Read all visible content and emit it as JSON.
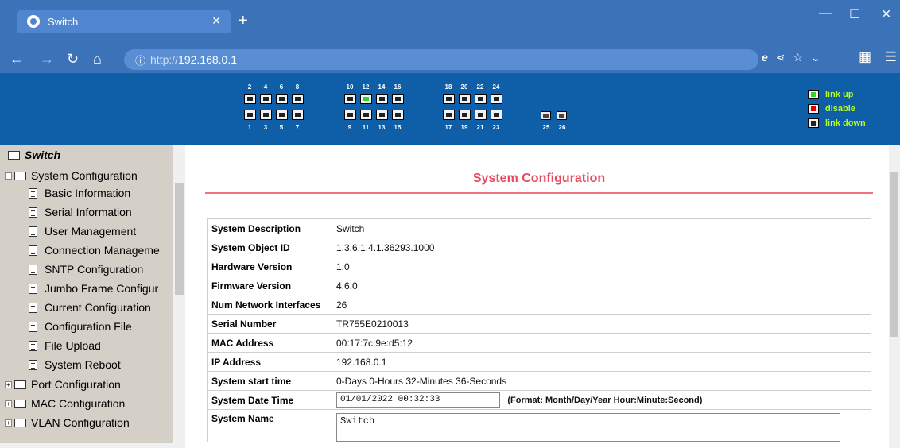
{
  "browser": {
    "tab_title": "Switch",
    "url_proto": "http://",
    "url_host": "192.168.0.1",
    "accent": "#3c72b8"
  },
  "ports": {
    "top_labels": [
      "2",
      "4",
      "6",
      "8",
      "10",
      "12",
      "14",
      "16",
      "18",
      "20",
      "22",
      "24"
    ],
    "bottom_labels": [
      "1",
      "3",
      "5",
      "7",
      "9",
      "11",
      "13",
      "15",
      "17",
      "19",
      "21",
      "23",
      "25",
      "26"
    ],
    "up_port": "12"
  },
  "legend": {
    "link_up": "link up",
    "disable": "disable",
    "link_down": "link down"
  },
  "sidebar": {
    "root": "Switch",
    "section": "System Configuration",
    "items": [
      "Basic Information",
      "Serial Information",
      "User Management",
      "Connection Manageme",
      "SNTP Configuration",
      "Jumbo Frame Configur",
      "Current Configuration",
      "Configuration File",
      "File Upload",
      "System Reboot"
    ],
    "collapsed": [
      "Port Configuration",
      "MAC Configuration",
      "VLAN Configuration"
    ]
  },
  "main": {
    "title": "System Configuration",
    "rows": [
      {
        "key": "System Description",
        "value": "Switch"
      },
      {
        "key": "System Object ID",
        "value": "1.3.6.1.4.1.36293.1000"
      },
      {
        "key": "Hardware Version",
        "value": "1.0"
      },
      {
        "key": "Firmware Version",
        "value": "4.6.0"
      },
      {
        "key": "Num Network Interfaces",
        "value": "26"
      },
      {
        "key": "Serial Number",
        "value": "TR755E0210013"
      },
      {
        "key": "MAC Address",
        "value": "00:17:7c:9e:d5:12"
      },
      {
        "key": "IP Address",
        "value": "192.168.0.1"
      },
      {
        "key": "System start time",
        "value": "0-Days 0-Hours 32-Minutes 36-Seconds"
      }
    ],
    "datetime_label": "System Date Time",
    "datetime_value": "01/01/2022 00:32:33",
    "datetime_format": "(Format: Month/Day/Year Hour:Minute:Second)",
    "name_label": "System Name",
    "name_value": "Switch"
  }
}
